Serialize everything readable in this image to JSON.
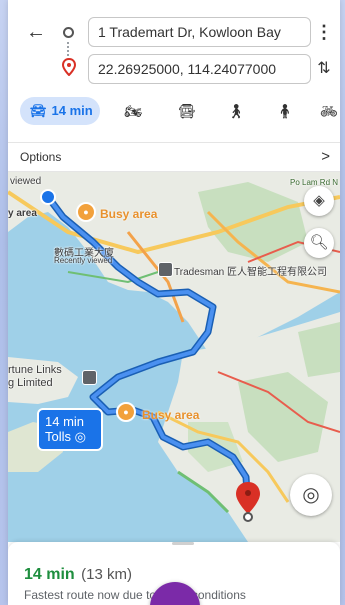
{
  "header": {
    "back_icon": "arrow-back-icon",
    "menu_icon": "more-vert-icon",
    "swap_icon": "swap-vert-icon",
    "origin": "1 Trademart Dr, Kowloon Bay",
    "destination": "22.26925000, 114.24077000"
  },
  "modes": {
    "active_label": "14 min",
    "items": [
      "car",
      "motorcycle",
      "transit",
      "walk",
      "ride-hailing",
      "bicycle"
    ]
  },
  "options": {
    "label": "Options",
    "chevron": ">"
  },
  "map": {
    "labels": {
      "viewed_top": "viewed",
      "area_left": "y area",
      "busy_top": "Busy area",
      "busy_mid": "Busy area",
      "recent_cn": "數碼工業大廈",
      "recent_sub": "Recently viewed",
      "tradesman": "Tradesman 匠人智能工程有限公司",
      "fortune": "rtune Links",
      "fortune2": "g Limited",
      "poe_cam": "Po Lam Rd N"
    },
    "route_badge_line1": "14 min",
    "route_badge_line2": "Tolls ◎",
    "route_color": "#1a73e8",
    "water_color": "#9fd0e8",
    "land_color": "#ebe9e3"
  },
  "sheet": {
    "eta": "14 min",
    "distance": "(13 km)",
    "summary": "Fastest route now due to traffic conditions"
  }
}
